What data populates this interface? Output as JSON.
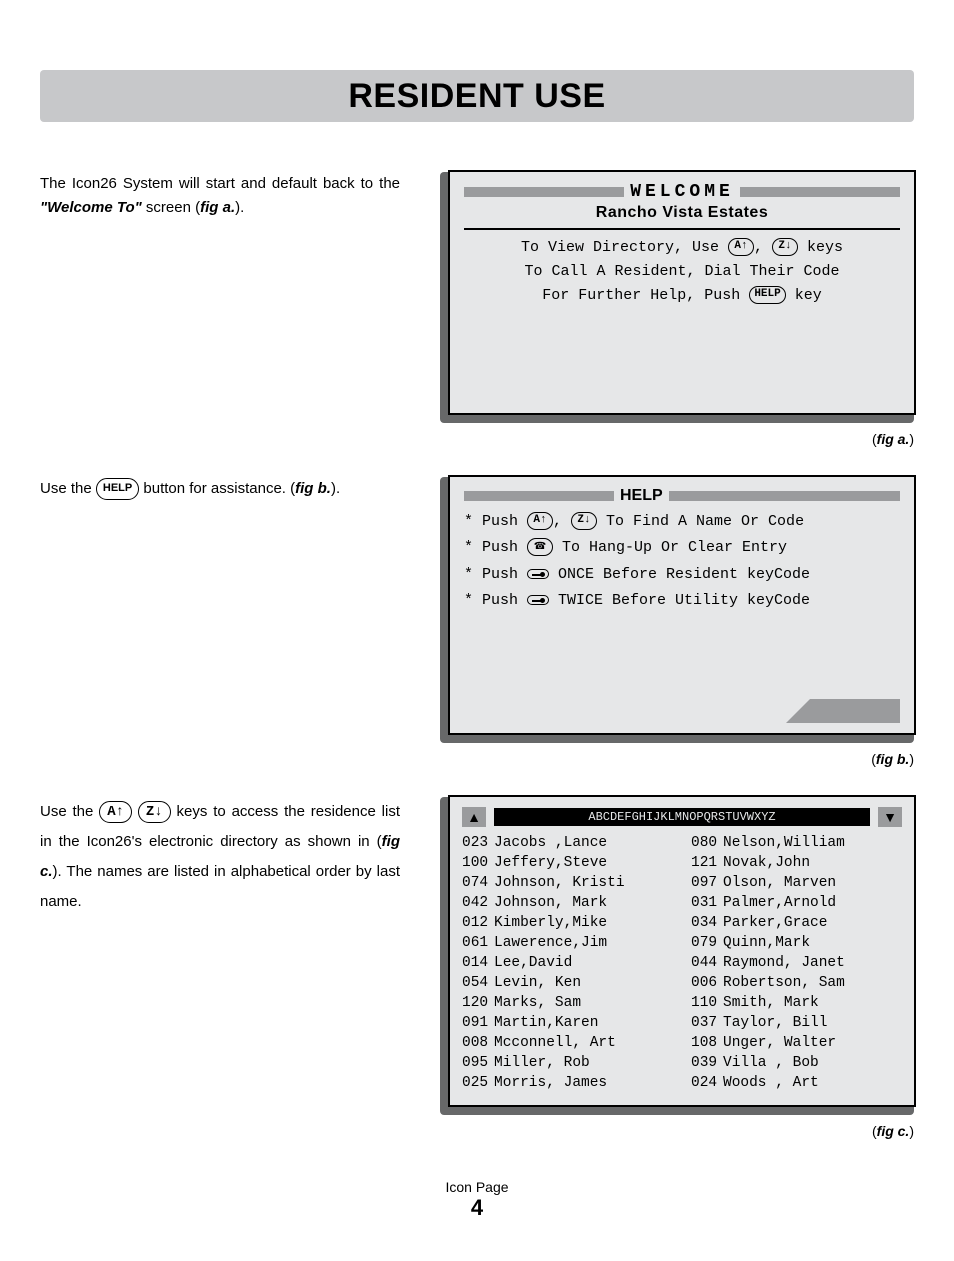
{
  "header": {
    "title": "RESIDENT USE"
  },
  "body_text": {
    "p1a": "The Icon26 System will start and default back to the ",
    "p1b": "\"Welcome To\"",
    "p1c": " screen (",
    "p1d": "fig a.",
    "p1e": ").",
    "p2a": "Use the ",
    "p2b": "HELP",
    "p2c": " button for assistance. (",
    "p2d": "fig b.",
    "p2e": ").",
    "p3a": "Use the ",
    "p3b": "A↑",
    "p3c": "Z↓",
    "p3d": " keys to access the residence list in the Icon26's electronic directory as shown in (",
    "p3e": "fig c.",
    "p3f": "). The names are listed in alphabetical order by last name."
  },
  "screen_a": {
    "title": "WELCOME",
    "subtitle": "Rancho Vista Estates",
    "line1a": "To View Directory, Use ",
    "key1": "A↑",
    "line1b": ", ",
    "key2": "Z↓",
    "line1c": " keys",
    "line2": "To Call A Resident, Dial Their Code",
    "line3a": "For Further Help, Push ",
    "key3": "HELP",
    "line3b": " key",
    "caption_prefix": "(",
    "caption_fig": "fig a.",
    "caption_suffix": ")"
  },
  "screen_b": {
    "title": "HELP",
    "l1a": "* Push ",
    "l1k1": "A↑",
    "l1b": ", ",
    "l1k2": "Z↓",
    "l1c": " To Find A Name Or Code",
    "l2a": "* Push ",
    "l2c": " To Hang-Up Or Clear Entry",
    "l3a": "* Push ",
    "l3c": " ONCE Before Resident keyCode",
    "l4a": "* Push ",
    "l4c": " TWICE Before Utility keyCode",
    "caption_prefix": "(",
    "caption_fig": "fig b.",
    "caption_suffix": ")"
  },
  "screen_c": {
    "az": "ABCDEFGHIJKLMNOPQRSTUVWXYZ",
    "col1": [
      {
        "code": "023",
        "name": "Jacobs ,Lance"
      },
      {
        "code": "100",
        "name": "Jeffery,Steve"
      },
      {
        "code": "074",
        "name": "Johnson, Kristi"
      },
      {
        "code": "042",
        "name": "Johnson, Mark"
      },
      {
        "code": "012",
        "name": "Kimberly,Mike"
      },
      {
        "code": "061",
        "name": "Lawerence,Jim"
      },
      {
        "code": "014",
        "name": "Lee,David"
      },
      {
        "code": "054",
        "name": "Levin, Ken"
      },
      {
        "code": "120",
        "name": "Marks, Sam"
      },
      {
        "code": "091",
        "name": "Martin,Karen"
      },
      {
        "code": "008",
        "name": "Mcconnell, Art"
      },
      {
        "code": "095",
        "name": "Miller, Rob"
      },
      {
        "code": "025",
        "name": "Morris, James"
      }
    ],
    "col2": [
      {
        "code": "080",
        "name": "Nelson,William"
      },
      {
        "code": "121",
        "name": "Novak,John"
      },
      {
        "code": "097",
        "name": "Olson, Marven"
      },
      {
        "code": "031",
        "name": "Palmer,Arnold"
      },
      {
        "code": "034",
        "name": "Parker,Grace"
      },
      {
        "code": "079",
        "name": "Quinn,Mark"
      },
      {
        "code": "044",
        "name": "Raymond, Janet"
      },
      {
        "code": "006",
        "name": "Robertson, Sam"
      },
      {
        "code": "110",
        "name": "Smith, Mark"
      },
      {
        "code": "037",
        "name": "Taylor, Bill"
      },
      {
        "code": "108",
        "name": "Unger, Walter"
      },
      {
        "code": "039",
        "name": "Villa , Bob"
      },
      {
        "code": "024",
        "name": "Woods , Art"
      }
    ],
    "caption_prefix": "(",
    "caption_fig": "fig c.",
    "caption_suffix": ")"
  },
  "footer": {
    "label": "Icon Page",
    "number": "4"
  }
}
